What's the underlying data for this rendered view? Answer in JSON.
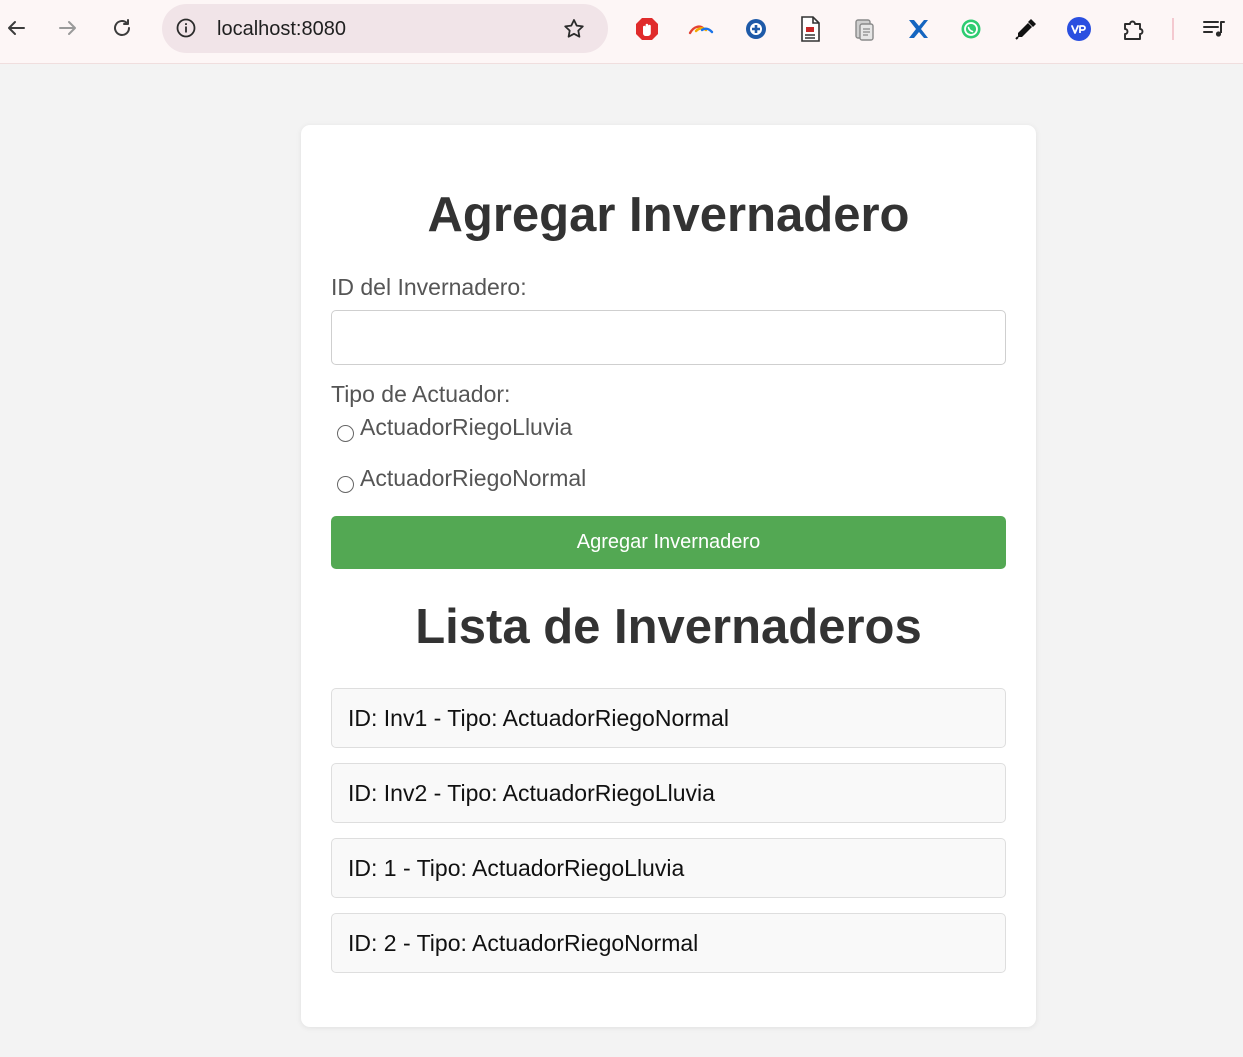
{
  "browser": {
    "url": "localhost:8080"
  },
  "form": {
    "title": "Agregar Invernadero",
    "id_label": "ID del Invernadero:",
    "id_value": "",
    "tipo_label": "Tipo de Actuador:",
    "options": [
      {
        "label": "ActuadorRiegoLluvia",
        "selected": false
      },
      {
        "label": "ActuadorRiegoNormal",
        "selected": false
      }
    ],
    "submit_label": "Agregar Invernadero"
  },
  "list": {
    "title": "Lista de Invernaderos",
    "items": [
      {
        "text": "ID: Inv1 - Tipo: ActuadorRiegoNormal"
      },
      {
        "text": "ID: Inv2 - Tipo: ActuadorRiegoLluvia"
      },
      {
        "text": "ID: 1 - Tipo: ActuadorRiegoLluvia"
      },
      {
        "text": "ID: 2 - Tipo: ActuadorRiegoNormal"
      }
    ]
  },
  "colors": {
    "page_bg": "#f3f3f3",
    "submit_bg": "#53a853",
    "heading": "#333333",
    "label": "#555555"
  },
  "icons": {
    "toolbar": [
      "back-arrow-icon",
      "forward-arrow-icon",
      "reload-icon",
      "info-icon",
      "bookmark-star-icon"
    ],
    "extensions": [
      "adblock-icon",
      "rainbow-arc-icon",
      "plus-circle-icon",
      "document-icon",
      "clipboard-icon",
      "cross-x-icon",
      "whatsapp-icon",
      "eyedropper-icon",
      "vpn-icon",
      "puzzle-extensions-icon",
      "media-playlist-icon"
    ]
  }
}
